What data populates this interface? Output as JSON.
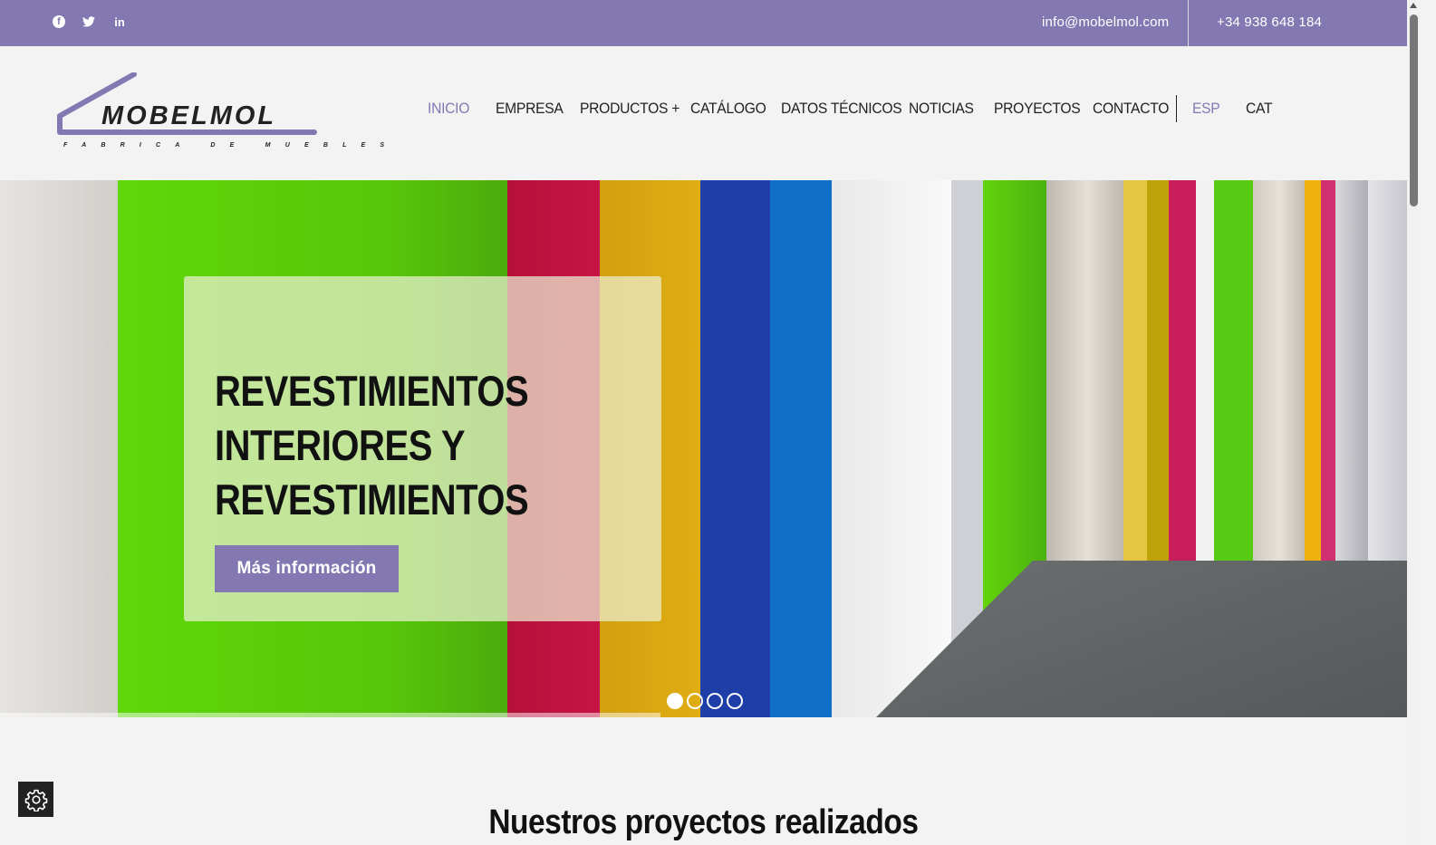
{
  "topbar": {
    "social": [
      {
        "icon": "facebook-icon",
        "glyph": "f"
      },
      {
        "icon": "twitter-icon",
        "glyph": "t"
      },
      {
        "icon": "linkedin-icon",
        "glyph": "in"
      }
    ],
    "email": "info@mobelmol.com",
    "phone": "+34 938 648 184",
    "bg_color": "#8478b3"
  },
  "logo": {
    "name": "MOBELMOL",
    "tagline": "FABRICA DE MUEBLES"
  },
  "nav": {
    "items": [
      {
        "label": "INICIO",
        "active": true
      },
      {
        "label": "EMPRESA"
      },
      {
        "label": "PRODUCTOS +"
      },
      {
        "label": "CATÁLOGO"
      },
      {
        "label": "DATOS TÉCNICOS"
      },
      {
        "label": "NOTICIAS"
      },
      {
        "label": "PROYECTOS"
      },
      {
        "label": "CONTACTO"
      }
    ],
    "languages": [
      {
        "label": "ESP",
        "active": true
      },
      {
        "label": "CAT"
      }
    ],
    "accent_color": "#8478b3"
  },
  "hero": {
    "title": "REVESTIMIENTOS INTERIORES Y REVESTIMIENTOS",
    "button_label": "Más información",
    "slides_count": 4,
    "active_slide": 1
  },
  "section": {
    "title": "Nuestros proyectos realizados"
  },
  "cookie": {
    "icon": "gear-icon"
  }
}
